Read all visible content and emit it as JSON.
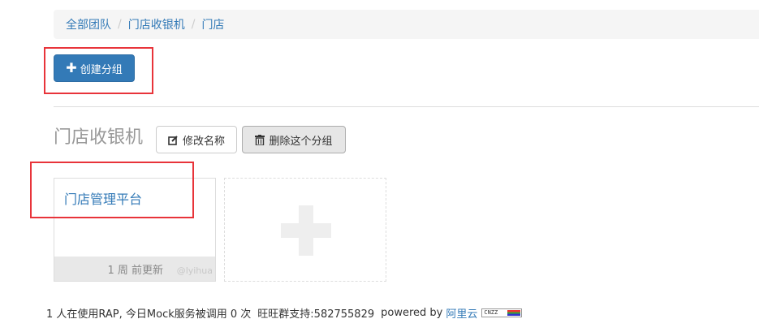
{
  "breadcrumb": {
    "items": [
      "全部团队",
      "门店收银机",
      "门店"
    ],
    "separator": "/"
  },
  "toolbar": {
    "create_group_label": "创建分组"
  },
  "group": {
    "title": "门店收银机",
    "rename_label": "修改名称",
    "delete_label": "删除这个分组"
  },
  "projects": [
    {
      "name": "门店管理平台",
      "updated": "1 周 前更新"
    }
  ],
  "watermark": "@lyihua",
  "footer": {
    "stats": "1 人在使用RAP, 今日Mock服务被调用 0 次",
    "support": "旺旺群支持:582755829",
    "powered_by": "powered by",
    "provider": "阿里云",
    "counter_badge": "CNZZ"
  },
  "colors": {
    "primary": "#337ab7",
    "highlight_box": "#e8343a"
  }
}
